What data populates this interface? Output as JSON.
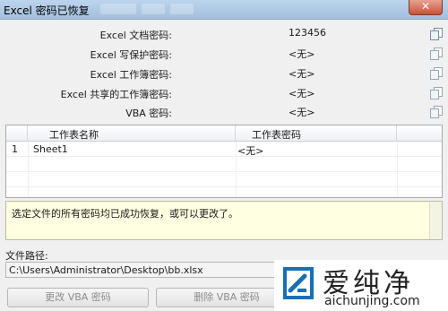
{
  "window": {
    "title": "Excel 密码已恢复",
    "close_label": "✕"
  },
  "passwords": [
    {
      "label": "Excel 文档密码:",
      "value": "123456"
    },
    {
      "label": "Excel 写保护密码:",
      "value": "<无>"
    },
    {
      "label": "Excel 工作簿密码:",
      "value": "<无>"
    },
    {
      "label": "Excel 共享的工作簿密码:",
      "value": "<无>"
    },
    {
      "label": "VBA 密码:",
      "value": "<无>"
    }
  ],
  "table": {
    "headers": [
      "工作表名称",
      "工作表密码"
    ],
    "rows": [
      {
        "num": "1",
        "name": "Sheet1",
        "password": "<无>"
      }
    ]
  },
  "status": "选定文件的所有密码均已成功恢复，或可以更改了。",
  "path": {
    "label": "文件路径:",
    "value": "C:\\Users\\Administrator\\Desktop\\bb.xlsx"
  },
  "buttons": {
    "change_vba": "更改 VBA 密码",
    "delete_vba": "删除 VBA 密码"
  },
  "icons": {
    "copy": "copy-icon",
    "logo": "aichunjing-logo"
  },
  "colors": {
    "status_bg": "#ffffe1",
    "titlebar": "#a4c0df",
    "close": "#c8533a",
    "brand": "#1a6fb5"
  },
  "watermark": {
    "text": "爱纯净",
    "url": "aichunjing.com"
  }
}
